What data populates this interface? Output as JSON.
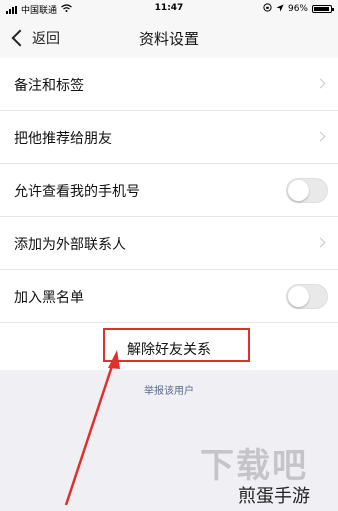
{
  "status_bar": {
    "carrier": "中国联通",
    "time": "11:47",
    "battery": "96%",
    "battery_level": 0.96
  },
  "nav": {
    "back_label": "返回",
    "title": "资料设置"
  },
  "settings": {
    "items": [
      {
        "label": "备注和标签",
        "control": "chevron"
      },
      {
        "label": "把他推荐给朋友",
        "control": "chevron"
      },
      {
        "label": "允许查看我的手机号",
        "control": "toggle",
        "on": false
      },
      {
        "label": "添加为外部联系人",
        "control": "chevron"
      },
      {
        "label": "加入黑名单",
        "control": "toggle",
        "on": false
      }
    ]
  },
  "remove_friend_label": "解除好友关系",
  "report_label": "举报该用户",
  "watermark": {
    "background_text": "下载吧",
    "text": "煎蛋手游"
  },
  "colors": {
    "highlight": "#e0302e",
    "link": "#5b6b8c"
  }
}
